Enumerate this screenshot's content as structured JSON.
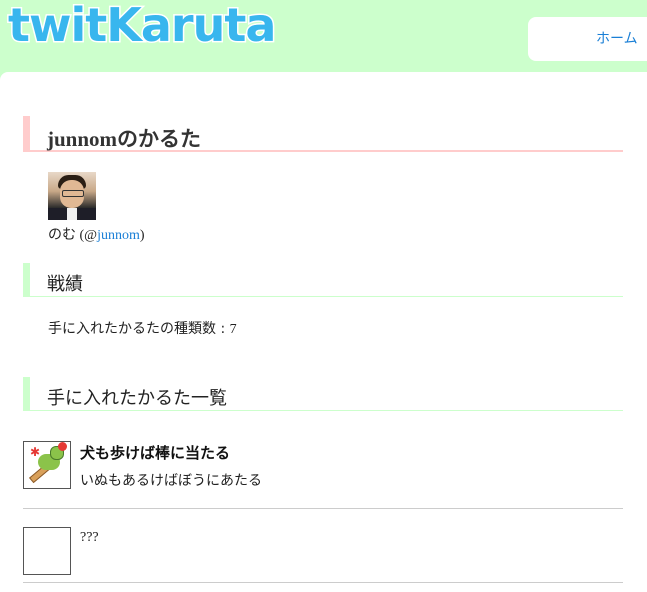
{
  "header": {
    "logo_text": "twitKaruta",
    "logo_color": "#38b6ee",
    "nav_home": "ホーム"
  },
  "page": {
    "title": "junnomのかるた"
  },
  "user": {
    "display_name": "のむ",
    "handle_prefix": "(@",
    "handle": "junnom",
    "handle_suffix": ")"
  },
  "stats": {
    "heading": "戦績",
    "label": "手に入れたかるたの種類数 : ",
    "count": "7"
  },
  "collection": {
    "heading": "手に入れたかるた一覧",
    "items": [
      {
        "title": "犬も歩けば棒に当たる",
        "reading": "いぬもあるけばぼうにあたる",
        "icon": "dog-karuta-icon"
      },
      {
        "title": "???",
        "reading": "",
        "icon": "blank-card-icon"
      }
    ]
  },
  "colors": {
    "background": "#ccffcc",
    "heading_accent_pink": "#ffcccc",
    "heading_accent_green": "#ccffcc",
    "link": "#1a7fd6"
  }
}
